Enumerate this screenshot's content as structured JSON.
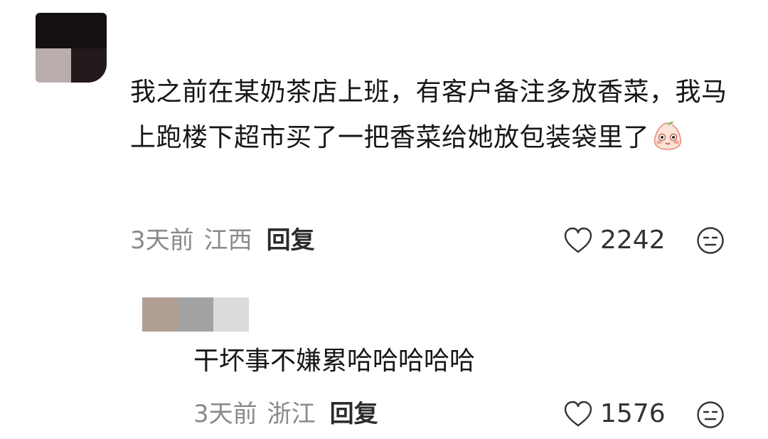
{
  "comment": {
    "text": "我之前在某奶茶店上班，有客户备注多放香菜，我马上跑楼下超市买了一把香菜给她放包装袋里了",
    "emoji_icon": "blush-face-emoji-icon",
    "time": "3天前",
    "location": "江西",
    "reply_label": "回复",
    "likes": "2242"
  },
  "reply": {
    "text": "干坏事不嫌累哈哈哈哈哈",
    "time": "3天前",
    "location": "浙江",
    "reply_label": "回复",
    "likes": "1576"
  },
  "colors": {
    "meta_gray": "#8a8a8a",
    "text": "#161616"
  }
}
